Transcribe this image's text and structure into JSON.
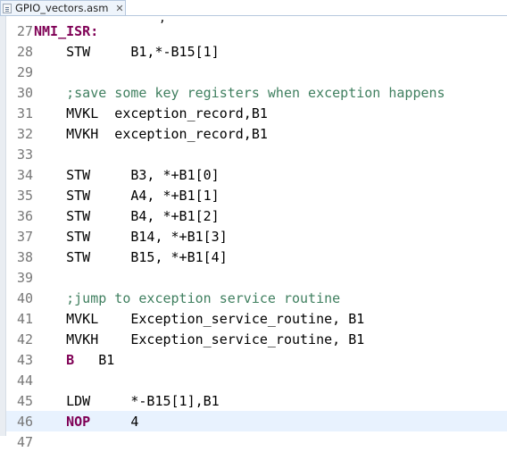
{
  "tab": {
    "filename": "GPIO_vectors.asm",
    "close_glyph": "✕",
    "icon": "asm-file-icon"
  },
  "editor": {
    "partial_top_text": "‚",
    "current_line": 46,
    "lines": [
      {
        "n": "27",
        "segments": [
          {
            "t": "NMI_ISR:",
            "cls": "k-label"
          }
        ]
      },
      {
        "n": "28",
        "segments": [
          {
            "t": "    STW     B1,*-B15[1]",
            "cls": "k-plain"
          }
        ]
      },
      {
        "n": "29",
        "segments": []
      },
      {
        "n": "30",
        "segments": [
          {
            "t": "    ;save some key registers when exception happens",
            "cls": "k-comment"
          }
        ]
      },
      {
        "n": "31",
        "segments": [
          {
            "t": "    MVKL  exception_record,B1",
            "cls": "k-plain"
          }
        ]
      },
      {
        "n": "32",
        "segments": [
          {
            "t": "    MVKH  exception_record,B1",
            "cls": "k-plain"
          }
        ]
      },
      {
        "n": "33",
        "segments": []
      },
      {
        "n": "34",
        "segments": [
          {
            "t": "    STW     B3, *+B1[0]",
            "cls": "k-plain"
          }
        ]
      },
      {
        "n": "35",
        "segments": [
          {
            "t": "    STW     A4, *+B1[1]",
            "cls": "k-plain"
          }
        ]
      },
      {
        "n": "36",
        "segments": [
          {
            "t": "    STW     B4, *+B1[2]",
            "cls": "k-plain"
          }
        ]
      },
      {
        "n": "37",
        "segments": [
          {
            "t": "    STW     B14, *+B1[3]",
            "cls": "k-plain"
          }
        ]
      },
      {
        "n": "38",
        "segments": [
          {
            "t": "    STW     B15, *+B1[4]",
            "cls": "k-plain"
          }
        ]
      },
      {
        "n": "39",
        "segments": []
      },
      {
        "n": "40",
        "segments": [
          {
            "t": "    ;jump to exception service routine",
            "cls": "k-comment"
          }
        ]
      },
      {
        "n": "41",
        "segments": [
          {
            "t": "    MVKL    Exception_service_routine, B1",
            "cls": "k-plain"
          }
        ]
      },
      {
        "n": "42",
        "segments": [
          {
            "t": "    MVKH    Exception_service_routine, B1",
            "cls": "k-plain"
          }
        ]
      },
      {
        "n": "43",
        "segments": [
          {
            "t": "    ",
            "cls": "k-plain"
          },
          {
            "t": "B",
            "cls": "k-kw"
          },
          {
            "t": "   B1",
            "cls": "k-plain"
          }
        ]
      },
      {
        "n": "44",
        "segments": []
      },
      {
        "n": "45",
        "segments": [
          {
            "t": "    LDW     *-B15[1],B1",
            "cls": "k-plain"
          }
        ]
      },
      {
        "n": "46",
        "segments": [
          {
            "t": "    ",
            "cls": "k-plain"
          },
          {
            "t": "NOP",
            "cls": "k-kw"
          },
          {
            "t": "     4",
            "cls": "k-plain"
          }
        ]
      },
      {
        "n": "47",
        "segments": []
      }
    ]
  }
}
